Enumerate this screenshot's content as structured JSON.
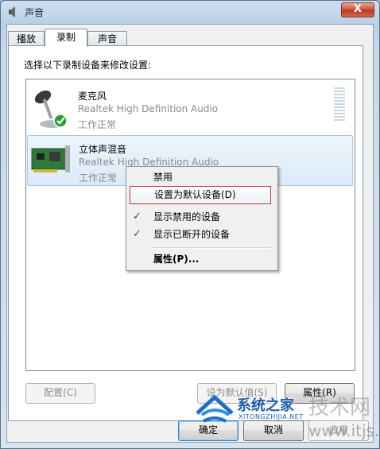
{
  "window": {
    "title": "声音",
    "close_label": "X"
  },
  "tabs": [
    {
      "label": "播放"
    },
    {
      "label": "录制"
    },
    {
      "label": "声音"
    }
  ],
  "instruction": "选择以下录制设备来修改设置:",
  "devices": [
    {
      "name": "麦克风",
      "driver": "Realtek High Definition Audio",
      "status": "工作正常"
    },
    {
      "name": "立体声混音",
      "driver": "Realtek High Definition Audio",
      "status": "工作正常"
    }
  ],
  "context_menu": {
    "items": [
      {
        "label": "禁用",
        "checked": false
      },
      {
        "label": "设置为默认设备(D)",
        "checked": false
      },
      {
        "label": "显示禁用的设备",
        "checked": true
      },
      {
        "label": "显示已断开的设备",
        "checked": true
      },
      {
        "label": "属性(P)...",
        "checked": false
      }
    ],
    "check_glyph": "✓"
  },
  "buttons": {
    "configure": "配置(C)",
    "set_default": "设为默认值(S)",
    "properties": "属性(R)",
    "ok": "确定",
    "cancel": "取消",
    "apply": "应用"
  },
  "watermark": {
    "brand": "系统之家",
    "brand_latin": "XITONGZHIJIA.NET",
    "logo_text": "技术网",
    "url": "www.itjs.cn"
  },
  "colors": {
    "selection": "#dbeaf9",
    "menu_highlight_border": "#b53a3a",
    "check": "#1b4b9a"
  }
}
